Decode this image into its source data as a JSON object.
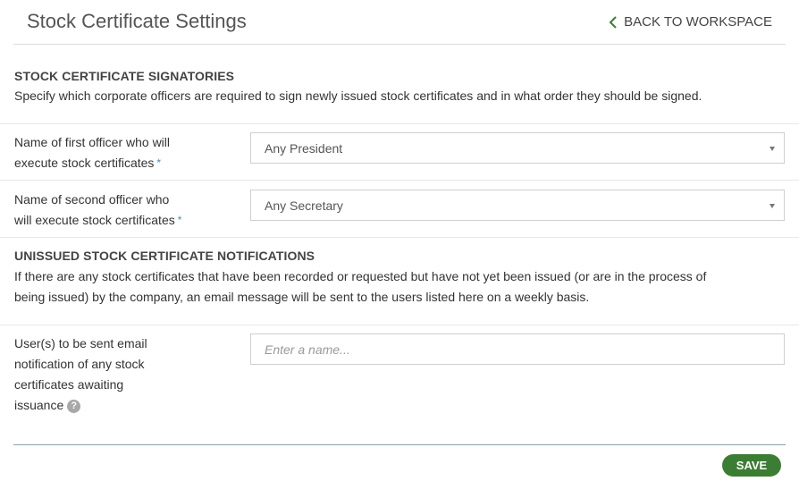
{
  "header": {
    "title": "Stock Certificate Settings",
    "back_label": "BACK TO WORKSPACE"
  },
  "signatories": {
    "heading": "STOCK CERTIFICATE SIGNATORIES",
    "description": "Specify which corporate officers are required to sign newly issued stock certificates and in what order they should be signed.",
    "first_officer": {
      "label_line1": "Name of first officer who will",
      "label_line2": "execute stock certificates",
      "required_mark": "*",
      "value": "Any President"
    },
    "second_officer": {
      "label_line1": "Name of second officer who",
      "label_line2": "will execute stock certificates",
      "required_mark": "*",
      "value": "Any Secretary"
    }
  },
  "notifications": {
    "heading": "UNISSUED STOCK CERTIFICATE NOTIFICATIONS",
    "description_line1": "If there are any stock certificates that have been recorded or requested but have not yet been issued (or are in the process of",
    "description_line2": "being issued) by the company, an email message will be sent to the users listed here on a weekly basis.",
    "users_field": {
      "label_line1": "User(s) to be sent email",
      "label_line2": "notification of any stock",
      "label_line3": "certificates awaiting",
      "label_line4": "issuance",
      "help_glyph": "?",
      "placeholder": "Enter a name..."
    }
  },
  "footer": {
    "save_label": "SAVE"
  },
  "colors": {
    "save_button": "#3c7d34",
    "back_chevron": "#3c7d34",
    "required_mark": "#3b8fd0"
  }
}
